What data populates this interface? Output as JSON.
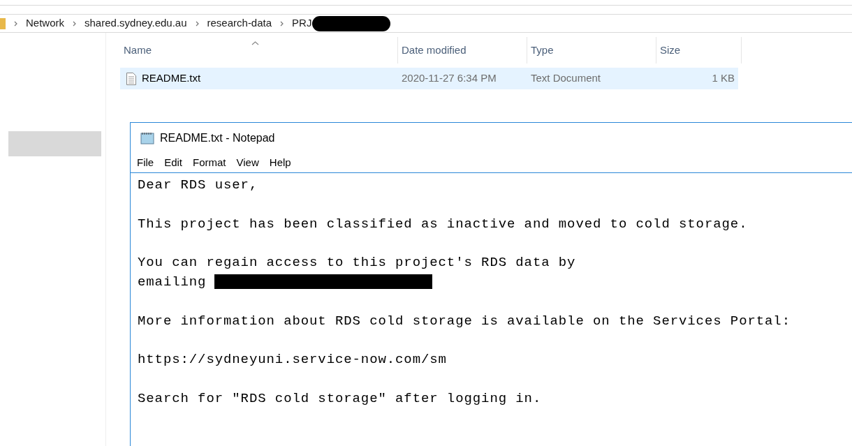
{
  "breadcrumb": [
    "Network",
    "shared.sydney.edu.au",
    "research-data",
    "PRJ"
  ],
  "file_list": {
    "columns": [
      "Name",
      "Date modified",
      "Type",
      "Size"
    ],
    "rows": [
      {
        "name": "README.txt",
        "date_modified": "2020-11-27 6:34 PM",
        "type": "Text Document",
        "size": "1 KB",
        "selected": true
      }
    ]
  },
  "notepad": {
    "title": "README.txt - Notepad",
    "menu": [
      "File",
      "Edit",
      "Format",
      "View",
      "Help"
    ],
    "paragraphs": [
      {
        "text": "Dear RDS user,"
      },
      {
        "text": "This project has been classified as inactive and moved to cold storage."
      },
      {
        "text": "You can regain access to this project's RDS data by"
      },
      {
        "text": "emailing",
        "redacted_tail": true,
        "joined": true
      },
      {
        "text": "More information about RDS cold storage is available on the Services Portal:"
      },
      {
        "text": "https://sydneyuni.service-now.com/sm"
      },
      {
        "text": "Search for \"RDS cold storage\" after logging in."
      }
    ]
  }
}
